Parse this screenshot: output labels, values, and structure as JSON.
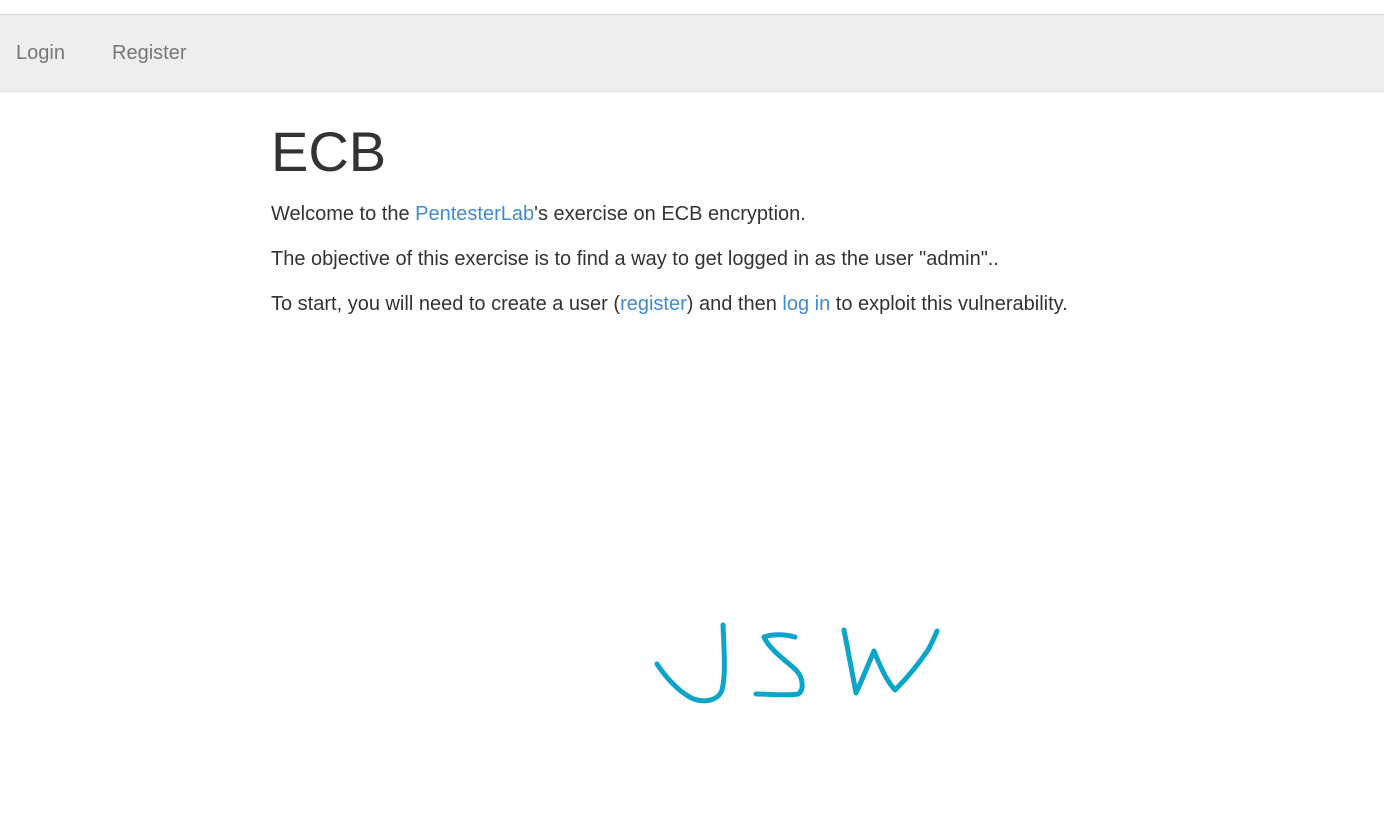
{
  "nav": {
    "items": [
      {
        "label": "Login"
      },
      {
        "label": "Register"
      }
    ]
  },
  "page": {
    "title": "ECB",
    "welcome": {
      "prefix": "Welcome to the ",
      "link": "PentesterLab",
      "suffix": "'s exercise on ECB encryption."
    },
    "objective": "The objective of this exercise is to find a way to get logged in as the user \"admin\"..",
    "start": {
      "prefix": "To start, you will need to create a user (",
      "register_link": "register",
      "middle": ") and then ",
      "login_link": "log in",
      "suffix": " to exploit this vulnerability."
    }
  },
  "signature": {
    "text": "JSW",
    "color": "#0aa5c9"
  },
  "colors": {
    "link": "#428bca",
    "navbar_bg": "#eeeeee",
    "text": "#333333"
  }
}
